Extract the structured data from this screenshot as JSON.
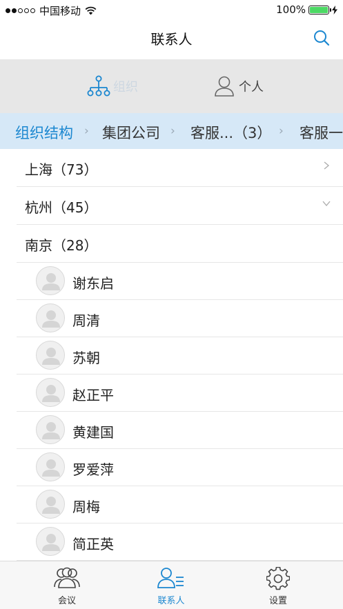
{
  "status_bar": {
    "carrier": "中国移动",
    "battery_text": "100%",
    "battery_level": 1.0
  },
  "header": {
    "title": "联系人"
  },
  "segment": {
    "org_label": "组织",
    "person_label": "个人"
  },
  "breadcrumb": [
    "组织结构",
    "集团公司",
    "客服...（3）",
    "客服一"
  ],
  "groups": [
    {
      "label": "上海（73）",
      "expanded": false
    },
    {
      "label": "杭州（45）",
      "expanded": true
    },
    {
      "label": "南京（28）"
    }
  ],
  "contacts": [
    "谢东启",
    "周清",
    "苏朝",
    "赵正平",
    "黄建国",
    "罗爱萍",
    "周梅",
    "简正英"
  ],
  "tabbar": {
    "items": [
      {
        "label": "会议",
        "icon": "meeting-icon"
      },
      {
        "label": "联系人",
        "icon": "contacts-icon"
      },
      {
        "label": "设置",
        "icon": "gear-icon"
      }
    ],
    "active_index": 1
  },
  "colors": {
    "accent": "#1b87d0",
    "breadcrumb_bg": "#d6e8f7",
    "segment_bg": "#e7e7e7",
    "battery": "#4cd964"
  }
}
